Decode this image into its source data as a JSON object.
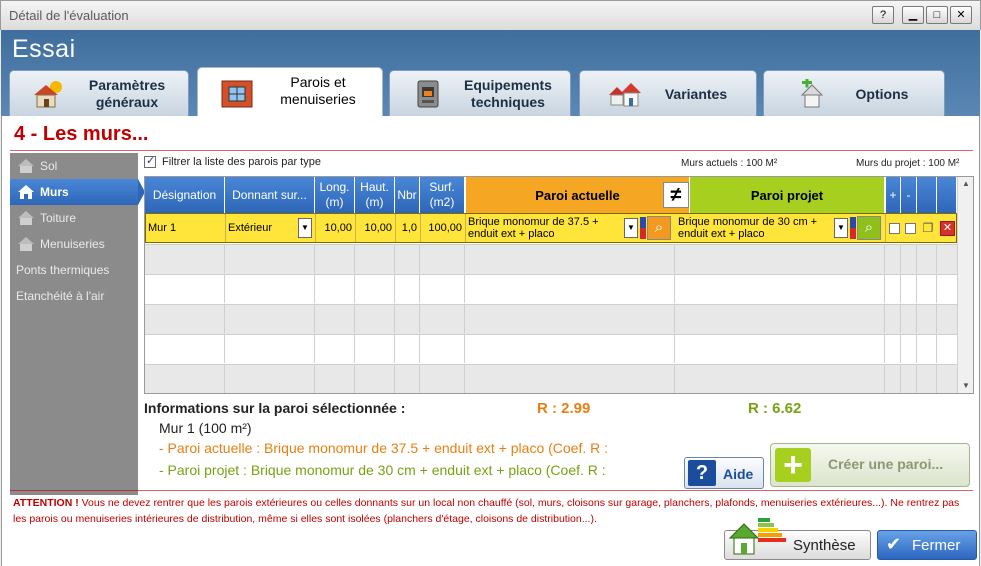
{
  "window": {
    "title": "Détail de l'évaluation",
    "help": "?",
    "minimize": "▁",
    "maximize": "□",
    "close": "✕"
  },
  "app_title": "Essai",
  "tabs": [
    {
      "label": "Paramètres généraux",
      "icon": "sun-house-icon"
    },
    {
      "label": "Parois et menuiseries",
      "icon": "brick-wall-icon",
      "active": true
    },
    {
      "label": "Equipements techniques",
      "icon": "boiler-icon"
    },
    {
      "label": "Variantes",
      "icon": "houses-icon"
    },
    {
      "label": "Options",
      "icon": "house-plus-icon"
    }
  ],
  "section_title": "4 - Les murs...",
  "sidebar": [
    {
      "label": "Sol",
      "icon": "house-icon"
    },
    {
      "label": "Murs",
      "icon": "house-icon",
      "active": true
    },
    {
      "label": "Toiture",
      "icon": "house-icon"
    },
    {
      "label": "Menuiseries",
      "icon": "house-icon"
    },
    {
      "label": "Ponts thermiques"
    },
    {
      "label": "Etanchéité à l'air"
    }
  ],
  "filter_label": "Filtrer la liste des parois par type",
  "murs_actuels": "Murs actuels : 100 M²",
  "murs_projet": "Murs du projet : 100 M²",
  "table": {
    "headers": {
      "designation": "Désignation",
      "donnant": "Donnant sur...",
      "long": "Long. (m)",
      "haut": "Haut. (m)",
      "nbr": "Nbr",
      "surf": "Surf. (m2)",
      "paroi_actuelle": "Paroi actuelle",
      "paroi_projet": "Paroi projet",
      "plus": "+",
      "minus": "-",
      "neq": "≠"
    },
    "row": {
      "designation": "Mur 1",
      "donnant": "Extérieur",
      "long": "10,00",
      "haut": "10,00",
      "nbr": "1,0",
      "surf": "100,00",
      "paroi_actuelle": "Brique monomur de 37.5 + enduit ext + placo",
      "paroi_projet": "Brique monomur de 30 cm + enduit ext + placo"
    }
  },
  "info": {
    "title": "Informations sur la paroi sélectionnée :",
    "r_actuel": "R : 2.99",
    "r_projet": "R : 6.62",
    "line1": "Mur 1 (100 m²)",
    "line2": "- Paroi actuelle : Brique monomur de 37.5 + enduit ext + placo (Coef. R :",
    "line3": "- Paroi projet : Brique monomur de 30 cm + enduit ext + placo (Coef. R :"
  },
  "buttons": {
    "aide": "Aide",
    "creer": "Créer une paroi...",
    "synthese": "Synthèse",
    "fermer": "Fermer"
  },
  "attention": {
    "prefix": "ATTENTION !",
    "text": " Vous ne devez rentrer que les parois extérieures ou celles donnants sur un local non chauffé (sol, murs, cloisons sur garage, planchers, plafonds, menuiseries extérieures...). Ne rentrez pas les parois ou menuiseries intérieures de distribution, même si elles sont isolées (planchers d'étage, cloisons de distribution...)."
  },
  "colors": {
    "header_blue": "#3f6e9d",
    "accent_red": "#c00000",
    "orange": "#f5a623",
    "green": "#a6cf1f",
    "selected_row": "#ffe43a"
  }
}
